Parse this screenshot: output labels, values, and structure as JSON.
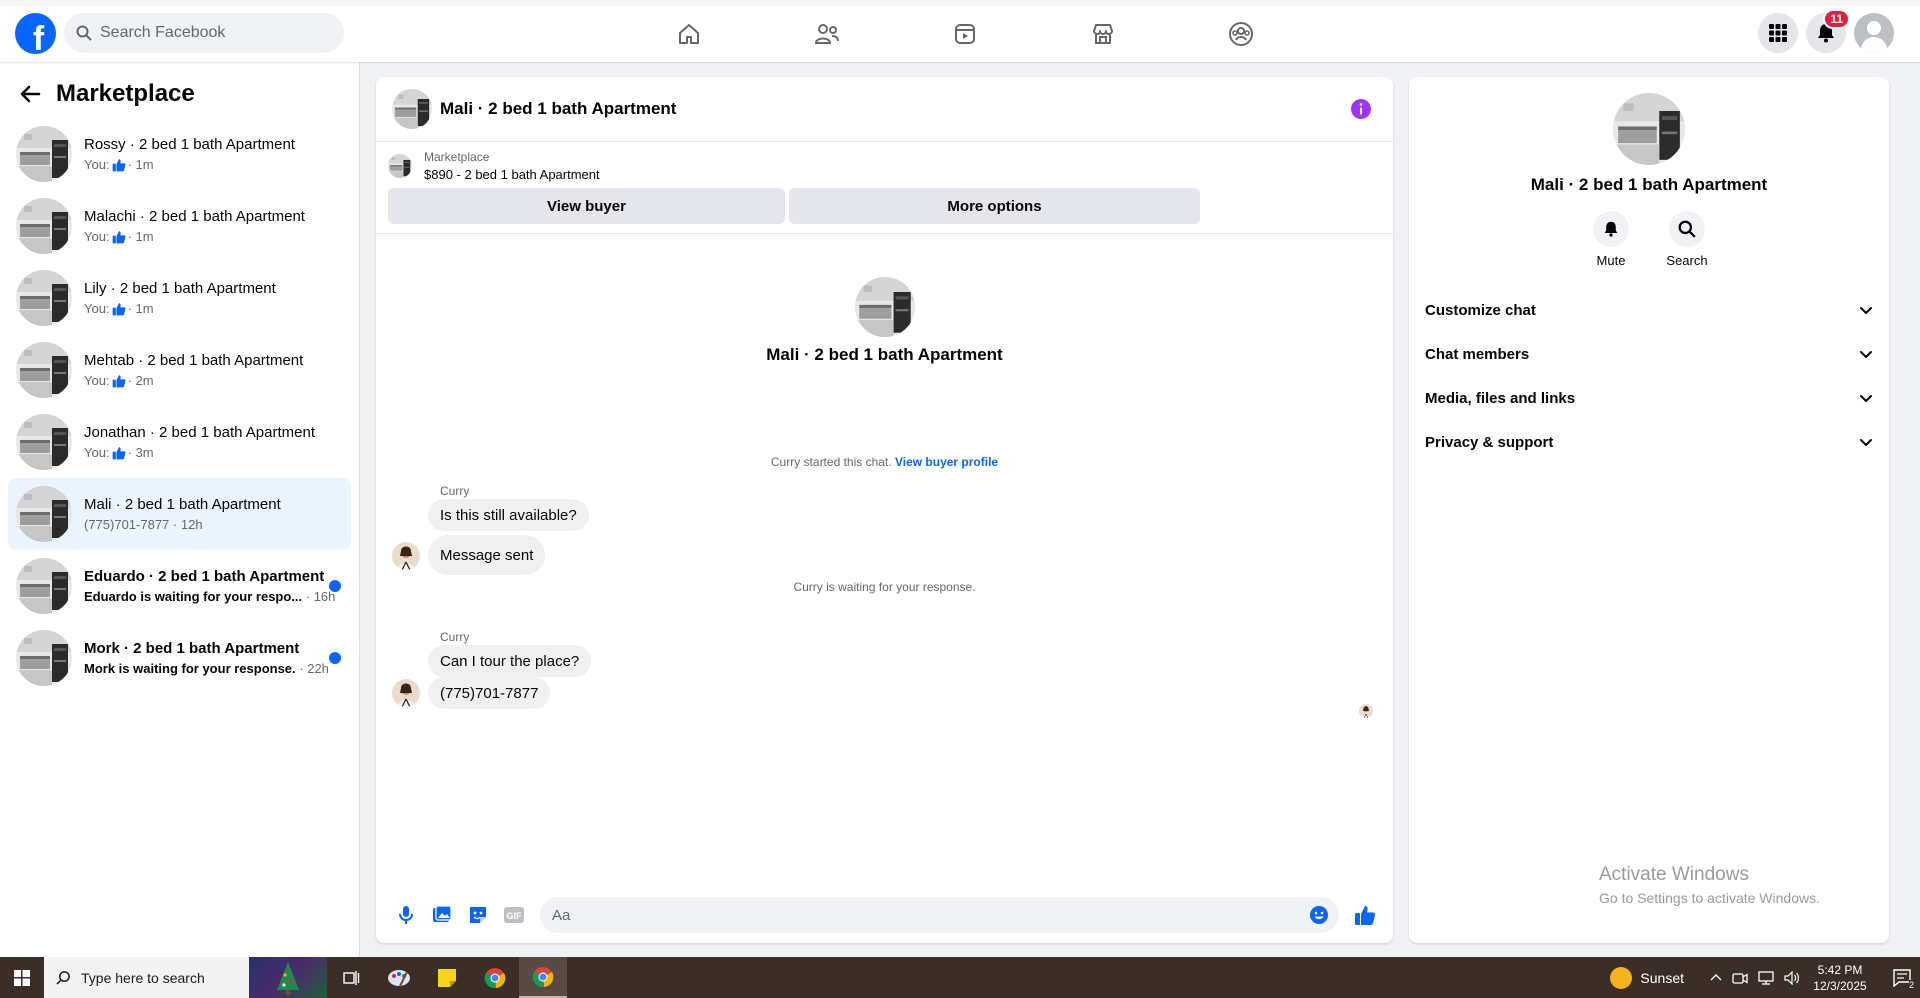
{
  "topbar": {
    "logo_letter": "f",
    "search_placeholder": "Search Facebook",
    "notifications_count": "11",
    "nav": [
      "home-icon",
      "friends-icon",
      "video-icon",
      "marketplace-icon",
      "groups-icon"
    ]
  },
  "sidebar": {
    "title": "Marketplace",
    "conversations": [
      {
        "name": "Rossy · 2 bed 1 bath Apartment",
        "prefix": "You:",
        "like": true,
        "time": "· 1m",
        "unread": false,
        "active": false
      },
      {
        "name": "Malachi · 2 bed 1 bath Apartment",
        "prefix": "You:",
        "like": true,
        "time": "· 1m",
        "unread": false,
        "active": false
      },
      {
        "name": "Lily · 2 bed 1 bath Apartment",
        "prefix": "You:",
        "like": true,
        "time": "· 1m",
        "unread": false,
        "active": false
      },
      {
        "name": "Mehtab · 2 bed 1 bath Apartment",
        "prefix": "You:",
        "like": true,
        "time": "· 2m",
        "unread": false,
        "active": false
      },
      {
        "name": "Jonathan · 2 bed 1 bath Apartment",
        "prefix": "You:",
        "like": true,
        "time": "· 3m",
        "unread": false,
        "active": false
      },
      {
        "name": "Mali · 2 bed 1 bath Apartment",
        "prefix": "(775)701-7877",
        "like": false,
        "time": "· 12h",
        "unread": false,
        "active": true
      },
      {
        "name": "Eduardo · 2 bed 1 bath Apartment",
        "prefix": "Eduardo is waiting for your respo...",
        "like": false,
        "time": "· 16h",
        "unread": true,
        "active": false
      },
      {
        "name": "Mork · 2 bed 1 bath Apartment",
        "prefix": "Mork is waiting for your response.",
        "like": false,
        "time": "· 22h",
        "unread": true,
        "active": false
      }
    ]
  },
  "chat": {
    "title": "Mali · 2 bed 1 bath Apartment",
    "listing_label": "Marketplace",
    "listing_title": "$890 - 2 bed 1 bath Apartment",
    "view_buyer": "View buyer",
    "more_options": "More options",
    "intro_title": "Mali · 2 bed 1 bath Apartment",
    "started_text": "Curry started this chat.",
    "view_buyer_profile": "View buyer profile",
    "waiting_text": "Curry is waiting for your response.",
    "group1": {
      "sender": "Curry",
      "msg1": "Is this still available?",
      "msg2": "Message sent"
    },
    "group2": {
      "sender": "Curry",
      "msg1": "Can I tour the place?",
      "msg2": "(775)701-7877"
    },
    "composer_placeholder": "Aa"
  },
  "rpanel": {
    "title": "Mali · 2 bed 1 bath Apartment",
    "mute": "Mute",
    "search": "Search",
    "menu": [
      "Customize chat",
      "Chat members",
      "Media, files and links",
      "Privacy & support"
    ]
  },
  "watermark": {
    "line1": "Activate Windows",
    "line2": "Go to Settings to activate Windows."
  },
  "taskbar": {
    "search_placeholder": "Type here to search",
    "weather": "Sunset",
    "time": "5:42 PM",
    "date": "12/3/2025",
    "notif_count": "2"
  },
  "colors": {
    "brand": "#0866ff",
    "badge": "#e41e3f",
    "info": "#a033ff"
  }
}
